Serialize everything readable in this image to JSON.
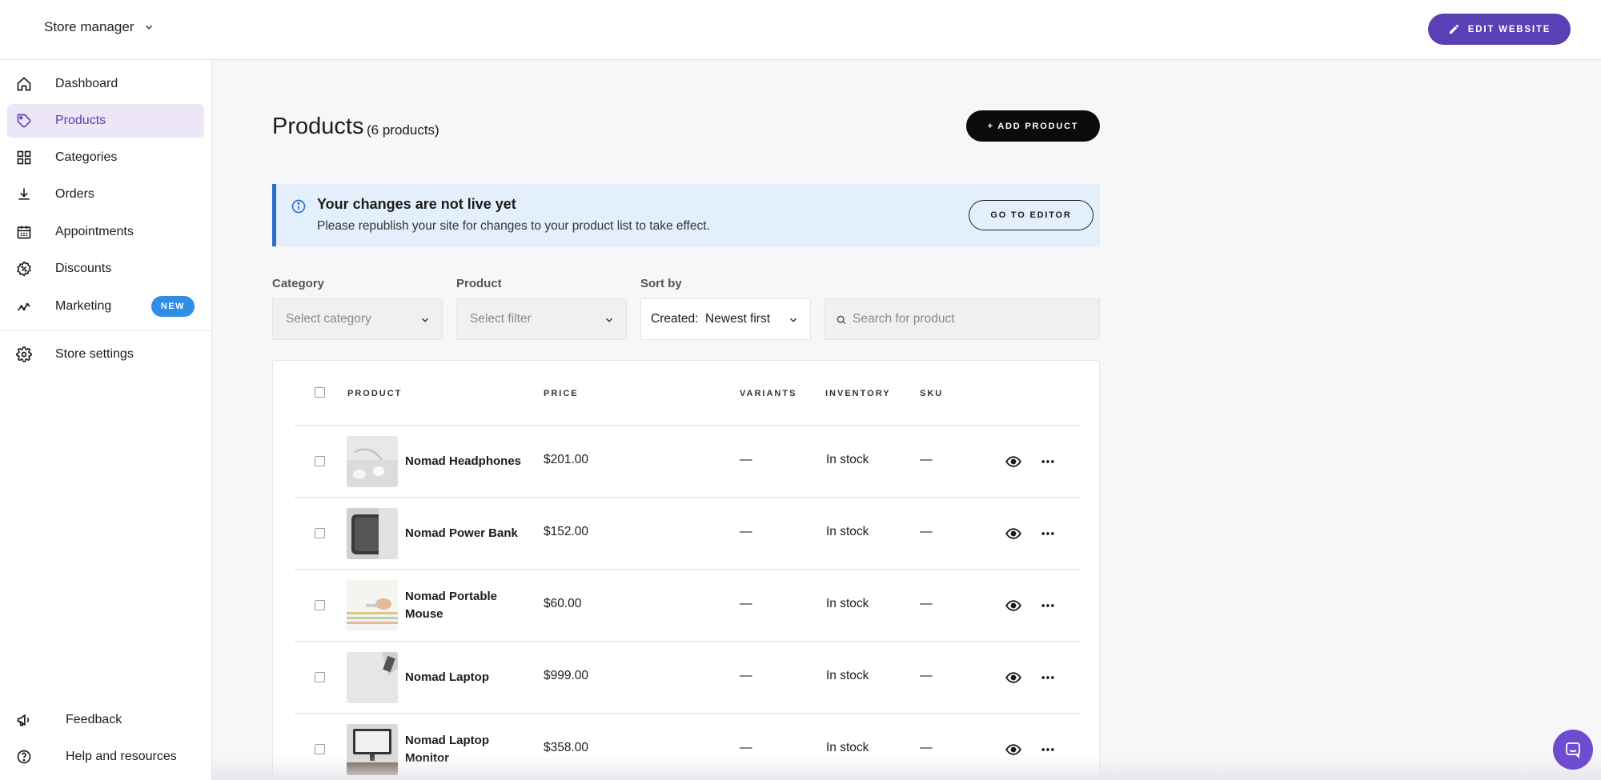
{
  "topbar": {
    "store_label": "Store manager",
    "edit_label": "EDIT WEBSITE"
  },
  "sidebar": {
    "items": [
      {
        "label": "Dashboard",
        "icon": "home-icon"
      },
      {
        "label": "Products",
        "icon": "tag-icon",
        "active": true
      },
      {
        "label": "Categories",
        "icon": "grid-icon"
      },
      {
        "label": "Orders",
        "icon": "download-icon"
      },
      {
        "label": "Appointments",
        "icon": "calendar-icon"
      },
      {
        "label": "Discounts",
        "icon": "badge-percent-icon"
      },
      {
        "label": "Marketing",
        "icon": "trend-icon",
        "badge": "NEW"
      }
    ],
    "settings_label": "Store settings",
    "feedback_label": "Feedback",
    "help_label": "Help and resources"
  },
  "main": {
    "title": "Products",
    "count": "(6 products)",
    "add_label": "+ ADD PRODUCT",
    "banner": {
      "title": "Your changes are not live yet",
      "text": "Please republish your site for changes to your product list to take effect.",
      "button": "GO TO EDITOR"
    },
    "filters": {
      "category_label": "Category",
      "category_placeholder": "Select category",
      "product_label": "Product",
      "product_placeholder": "Select filter",
      "sort_label": "Sort by",
      "sort_value": "Created:  Newest first",
      "search_placeholder": "Search for product"
    },
    "table": {
      "headers": {
        "product": "PRODUCT",
        "price": "PRICE",
        "variants": "VARIANTS",
        "inventory": "INVENTORY",
        "sku": "SKU"
      },
      "rows": [
        {
          "name": "Nomad Headphones",
          "price": "$201.00",
          "variants": "—",
          "inventory": "In stock",
          "sku": "—"
        },
        {
          "name": "Nomad Power Bank",
          "price": "$152.00",
          "variants": "—",
          "inventory": "In stock",
          "sku": "—"
        },
        {
          "name": "Nomad Portable Mouse",
          "price": "$60.00",
          "variants": "—",
          "inventory": "In stock",
          "sku": "—"
        },
        {
          "name": "Nomad Laptop",
          "price": "$999.00",
          "variants": "—",
          "inventory": "In stock",
          "sku": "—"
        },
        {
          "name": "Nomad Laptop Monitor",
          "price": "$358.00",
          "variants": "—",
          "inventory": "In stock",
          "sku": "—"
        }
      ]
    }
  },
  "colors": {
    "accent": "#5b3fb4",
    "badge": "#2f8ee6",
    "banner_bg": "#e3f0fb",
    "banner_border": "#2b70c8"
  }
}
